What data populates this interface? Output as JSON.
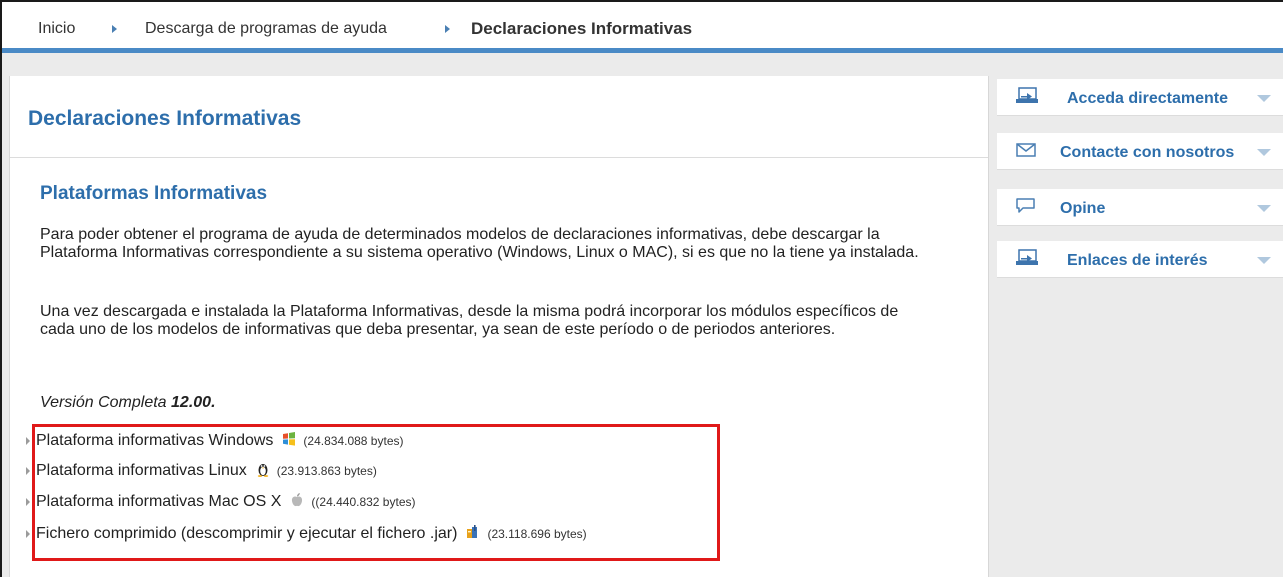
{
  "breadcrumb": {
    "items": [
      "Inicio",
      "Descarga de programas de ayuda"
    ],
    "current": "Declaraciones Informativas"
  },
  "main": {
    "page_title": "Declaraciones Informativas",
    "section_title": "Plataformas Informativas",
    "paragraphs": [
      "Para poder obtener el programa de ayuda de determinados modelos de declaraciones informativas, debe descargar la Plataforma Informativas correspondiente a su sistema operativo (Windows, Linux o MAC), si es que no la tiene ya instalada.",
      "Una vez descargada e instalada la Plataforma Informativas, desde la misma podrá incorporar los módulos específicos de cada uno de los modelos de informativas que deba presentar, ya sean de este período o de periodos anteriores."
    ],
    "version_prefix": "Versión Completa ",
    "version_number": "12.00."
  },
  "downloads": [
    {
      "label": "Plataforma informativas Windows",
      "icon": "windows-icon",
      "size": "(24.834.088 bytes)"
    },
    {
      "label": "Plataforma informativas Linux",
      "icon": "linux-tux-icon",
      "size": "(23.913.863 bytes)"
    },
    {
      "label": "Plataforma informativas Mac OS X",
      "icon": "apple-icon",
      "size": "((24.440.832 bytes)"
    },
    {
      "label": "Fichero comprimido (descomprimir y ejecutar el fichero .jar)",
      "icon": "java-archive-icon",
      "size": "(23.118.696 bytes)"
    }
  ],
  "sidebar": {
    "items": [
      {
        "label": "Acceda directamente",
        "icon": "computer-arrow-icon"
      },
      {
        "label": "Contacte con nosotros",
        "icon": "envelope-icon"
      },
      {
        "label": "Opine",
        "icon": "speech-bubble-icon"
      },
      {
        "label": "Enlaces de interés",
        "icon": "computer-arrow-icon"
      }
    ]
  },
  "colors": {
    "accent_blue": "#2d6eab",
    "breadcrumb_rule": "#4a8ac6",
    "highlight_red": "#e01919",
    "background_gray": "#ebebeb"
  }
}
